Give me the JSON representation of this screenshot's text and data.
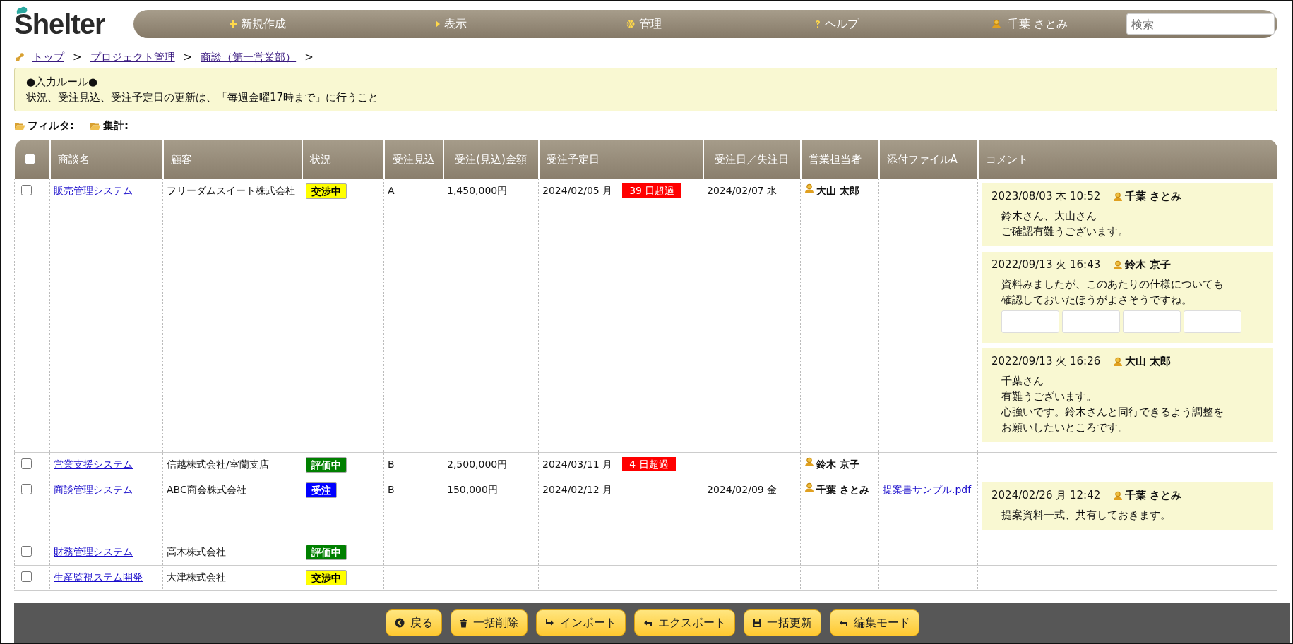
{
  "logo": {
    "text": "Shelter"
  },
  "nav": {
    "items": [
      {
        "kind": "create",
        "label": "新規作成"
      },
      {
        "kind": "view",
        "label": "表示"
      },
      {
        "kind": "admin",
        "label": "管理"
      },
      {
        "kind": "help",
        "label": "ヘルプ"
      },
      {
        "kind": "user",
        "label": "千葉 さとみ"
      }
    ],
    "search": {
      "placeholder": "検索"
    }
  },
  "breadcrumb": {
    "separator": ">",
    "items": [
      "トップ",
      "プロジェクト管理",
      "商談（第一営業部）"
    ]
  },
  "notice": {
    "title": "●入力ルール●",
    "body": "状況、受注見込、受注予定日の更新は、「毎週金曜17時まで」に行うこと"
  },
  "toolbar": [
    "フィルタ:",
    "集計:"
  ],
  "table": {
    "select_all": {
      "checked": false
    },
    "columns": [
      "商談名",
      "顧客",
      "状況",
      "受注見込",
      "受注(見込)金額",
      "受注予定日",
      "受注日／失注日",
      "営業担当者",
      "添付ファイルA",
      "コメント"
    ],
    "rows": [
      {
        "checked": false,
        "name": "販売管理システム",
        "customer": "フリーダムスイート株式会社",
        "status": {
          "label": "交渉中",
          "color": "#ffff00"
        },
        "prospect": "A",
        "amount": "1,450,000円",
        "due_date": "2024/02/05 月",
        "overdue": "39 日超過",
        "order_date": "2024/02/07 水",
        "rep": "大山 太郎",
        "attachment": "",
        "comments": [
          {
            "datetime": "2023/08/03 木 10:52",
            "author": "千葉 さとみ",
            "lines": [
              "鈴木さん、大山さん",
              "ご確認有難うございます。"
            ]
          },
          {
            "datetime": "2022/09/13 火 16:43",
            "author": "鈴木 京子",
            "lines": [
              "資料みましたが、このあたりの仕様についても",
              "確認しておいたほうがよさそうですね。"
            ],
            "thumbnails": [
              {
                "kind": "screenshot"
              },
              {
                "kind": "screenshot"
              },
              {
                "kind": "screenshot"
              },
              {
                "kind": "screenshot"
              }
            ]
          },
          {
            "datetime": "2022/09/13 火 16:26",
            "author": "大山 太郎",
            "lines": [
              "千葉さん",
              "有難うございます。",
              "心強いです。鈴木さんと同行できるよう調整を",
              "お願いしたいところです。"
            ]
          }
        ]
      },
      {
        "checked": false,
        "name": "営業支援システム",
        "customer": "信越株式会社/室蘭支店",
        "status": {
          "label": "評価中",
          "color": "#008000"
        },
        "prospect": "B",
        "amount": "2,500,000円",
        "due_date": "2024/03/11 月",
        "overdue": "4 日超過",
        "order_date": "",
        "rep": "鈴木 京子",
        "attachment": "",
        "comments": []
      },
      {
        "checked": false,
        "name": "商談管理システム",
        "customer": "ABC商会株式会社",
        "status": {
          "label": "受注",
          "color": "#0000ff"
        },
        "prospect": "B",
        "amount": "150,000円",
        "due_date": "2024/02/12 月",
        "overdue": "",
        "order_date": "2024/02/09 金",
        "rep": "千葉 さとみ",
        "attachment": "提案書サンプル.pdf",
        "comments": [
          {
            "datetime": "2024/02/26 月 12:42",
            "author": "千葉 さとみ",
            "lines": [
              "提案資料一式、共有しておきます。"
            ]
          }
        ]
      },
      {
        "checked": false,
        "name": "財務管理システム",
        "customer": "高木株式会社",
        "status": {
          "label": "評価中",
          "color": "#008000"
        },
        "prospect": "",
        "amount": "",
        "due_date": "",
        "overdue": "",
        "order_date": "",
        "rep": "",
        "attachment": "",
        "comments": []
      },
      {
        "checked": false,
        "name": "生産監視ステム開発",
        "customer": "大津株式会社",
        "status": {
          "label": "交渉中",
          "color": "#ffff00"
        },
        "prospect": "",
        "amount": "",
        "due_date": "",
        "overdue": "",
        "order_date": "",
        "rep": "",
        "attachment": "",
        "comments": []
      }
    ]
  },
  "actions": [
    {
      "kind": "back",
      "label": "戻る"
    },
    {
      "kind": "delete",
      "label": "一括削除"
    },
    {
      "kind": "import",
      "label": "インポート"
    },
    {
      "kind": "export",
      "label": "エクスポート"
    },
    {
      "kind": "save",
      "label": "一括更新"
    },
    {
      "kind": "edit",
      "label": "編集モード"
    }
  ]
}
